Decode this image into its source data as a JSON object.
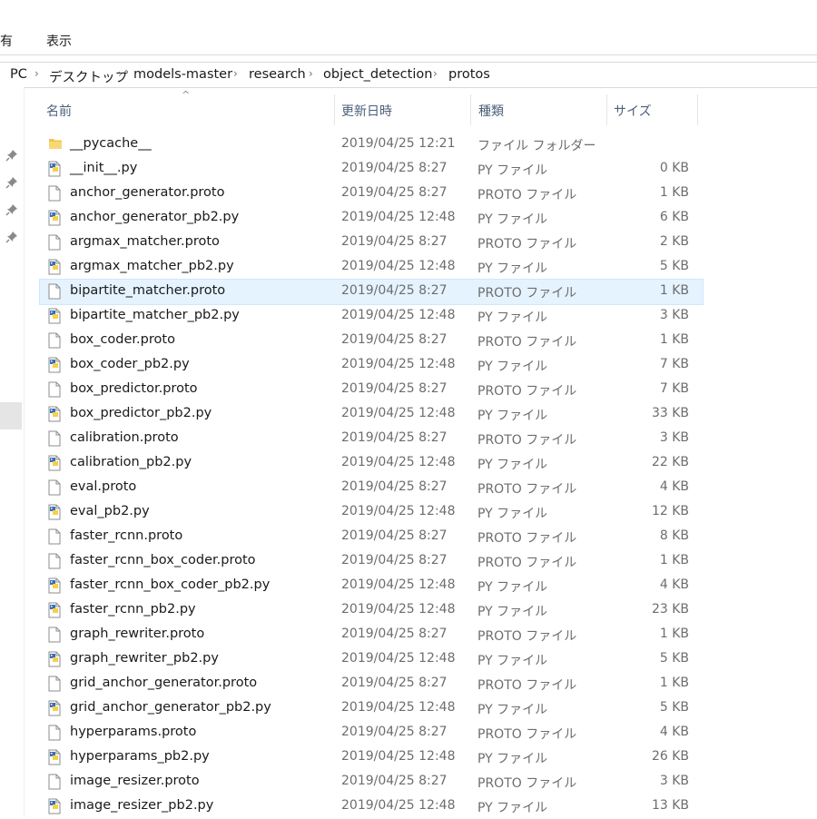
{
  "ribbon": {
    "tab_share": "有",
    "tab_view": "表示"
  },
  "breadcrumb": [
    "PC",
    "デスクトップ",
    "models-master",
    "research",
    "object_detection",
    "protos"
  ],
  "columns": {
    "name": "名前",
    "date": "更新日時",
    "type": "種類",
    "size": "サイズ"
  },
  "files": [
    {
      "name": "__pycache__",
      "date": "2019/04/25 12:21",
      "type": "ファイル フォルダー",
      "size": "",
      "icon": "folder-icon"
    },
    {
      "name": "__init__.py",
      "date": "2019/04/25 8:27",
      "type": "PY ファイル",
      "size": "0 KB",
      "icon": "python-file-icon"
    },
    {
      "name": "anchor_generator.proto",
      "date": "2019/04/25 8:27",
      "type": "PROTO ファイル",
      "size": "1 KB",
      "icon": "blank-file-icon"
    },
    {
      "name": "anchor_generator_pb2.py",
      "date": "2019/04/25 12:48",
      "type": "PY ファイル",
      "size": "6 KB",
      "icon": "python-file-icon"
    },
    {
      "name": "argmax_matcher.proto",
      "date": "2019/04/25 8:27",
      "type": "PROTO ファイル",
      "size": "2 KB",
      "icon": "blank-file-icon"
    },
    {
      "name": "argmax_matcher_pb2.py",
      "date": "2019/04/25 12:48",
      "type": "PY ファイル",
      "size": "5 KB",
      "icon": "python-file-icon"
    },
    {
      "name": "bipartite_matcher.proto",
      "date": "2019/04/25 8:27",
      "type": "PROTO ファイル",
      "size": "1 KB",
      "icon": "blank-file-icon",
      "selected": true
    },
    {
      "name": "bipartite_matcher_pb2.py",
      "date": "2019/04/25 12:48",
      "type": "PY ファイル",
      "size": "3 KB",
      "icon": "python-file-icon"
    },
    {
      "name": "box_coder.proto",
      "date": "2019/04/25 8:27",
      "type": "PROTO ファイル",
      "size": "1 KB",
      "icon": "blank-file-icon"
    },
    {
      "name": "box_coder_pb2.py",
      "date": "2019/04/25 12:48",
      "type": "PY ファイル",
      "size": "7 KB",
      "icon": "python-file-icon"
    },
    {
      "name": "box_predictor.proto",
      "date": "2019/04/25 8:27",
      "type": "PROTO ファイル",
      "size": "7 KB",
      "icon": "blank-file-icon"
    },
    {
      "name": "box_predictor_pb2.py",
      "date": "2019/04/25 12:48",
      "type": "PY ファイル",
      "size": "33 KB",
      "icon": "python-file-icon"
    },
    {
      "name": "calibration.proto",
      "date": "2019/04/25 8:27",
      "type": "PROTO ファイル",
      "size": "3 KB",
      "icon": "blank-file-icon"
    },
    {
      "name": "calibration_pb2.py",
      "date": "2019/04/25 12:48",
      "type": "PY ファイル",
      "size": "22 KB",
      "icon": "python-file-icon"
    },
    {
      "name": "eval.proto",
      "date": "2019/04/25 8:27",
      "type": "PROTO ファイル",
      "size": "4 KB",
      "icon": "blank-file-icon"
    },
    {
      "name": "eval_pb2.py",
      "date": "2019/04/25 12:48",
      "type": "PY ファイル",
      "size": "12 KB",
      "icon": "python-file-icon"
    },
    {
      "name": "faster_rcnn.proto",
      "date": "2019/04/25 8:27",
      "type": "PROTO ファイル",
      "size": "8 KB",
      "icon": "blank-file-icon"
    },
    {
      "name": "faster_rcnn_box_coder.proto",
      "date": "2019/04/25 8:27",
      "type": "PROTO ファイル",
      "size": "1 KB",
      "icon": "blank-file-icon"
    },
    {
      "name": "faster_rcnn_box_coder_pb2.py",
      "date": "2019/04/25 12:48",
      "type": "PY ファイル",
      "size": "4 KB",
      "icon": "python-file-icon"
    },
    {
      "name": "faster_rcnn_pb2.py",
      "date": "2019/04/25 12:48",
      "type": "PY ファイル",
      "size": "23 KB",
      "icon": "python-file-icon"
    },
    {
      "name": "graph_rewriter.proto",
      "date": "2019/04/25 8:27",
      "type": "PROTO ファイル",
      "size": "1 KB",
      "icon": "blank-file-icon"
    },
    {
      "name": "graph_rewriter_pb2.py",
      "date": "2019/04/25 12:48",
      "type": "PY ファイル",
      "size": "5 KB",
      "icon": "python-file-icon"
    },
    {
      "name": "grid_anchor_generator.proto",
      "date": "2019/04/25 8:27",
      "type": "PROTO ファイル",
      "size": "1 KB",
      "icon": "blank-file-icon"
    },
    {
      "name": "grid_anchor_generator_pb2.py",
      "date": "2019/04/25 12:48",
      "type": "PY ファイル",
      "size": "5 KB",
      "icon": "python-file-icon"
    },
    {
      "name": "hyperparams.proto",
      "date": "2019/04/25 8:27",
      "type": "PROTO ファイル",
      "size": "4 KB",
      "icon": "blank-file-icon"
    },
    {
      "name": "hyperparams_pb2.py",
      "date": "2019/04/25 12:48",
      "type": "PY ファイル",
      "size": "26 KB",
      "icon": "python-file-icon"
    },
    {
      "name": "image_resizer.proto",
      "date": "2019/04/25 8:27",
      "type": "PROTO ファイル",
      "size": "3 KB",
      "icon": "blank-file-icon"
    },
    {
      "name": "image_resizer_pb2.py",
      "date": "2019/04/25 12:48",
      "type": "PY ファイル",
      "size": "13 KB",
      "icon": "python-file-icon"
    }
  ],
  "colors": {
    "selection_bg": "#e5f3ff",
    "header_text": "#4c607a",
    "folder": "#f3c34b",
    "python_blue": "#3b6fb6",
    "python_yellow": "#f5d14a"
  }
}
